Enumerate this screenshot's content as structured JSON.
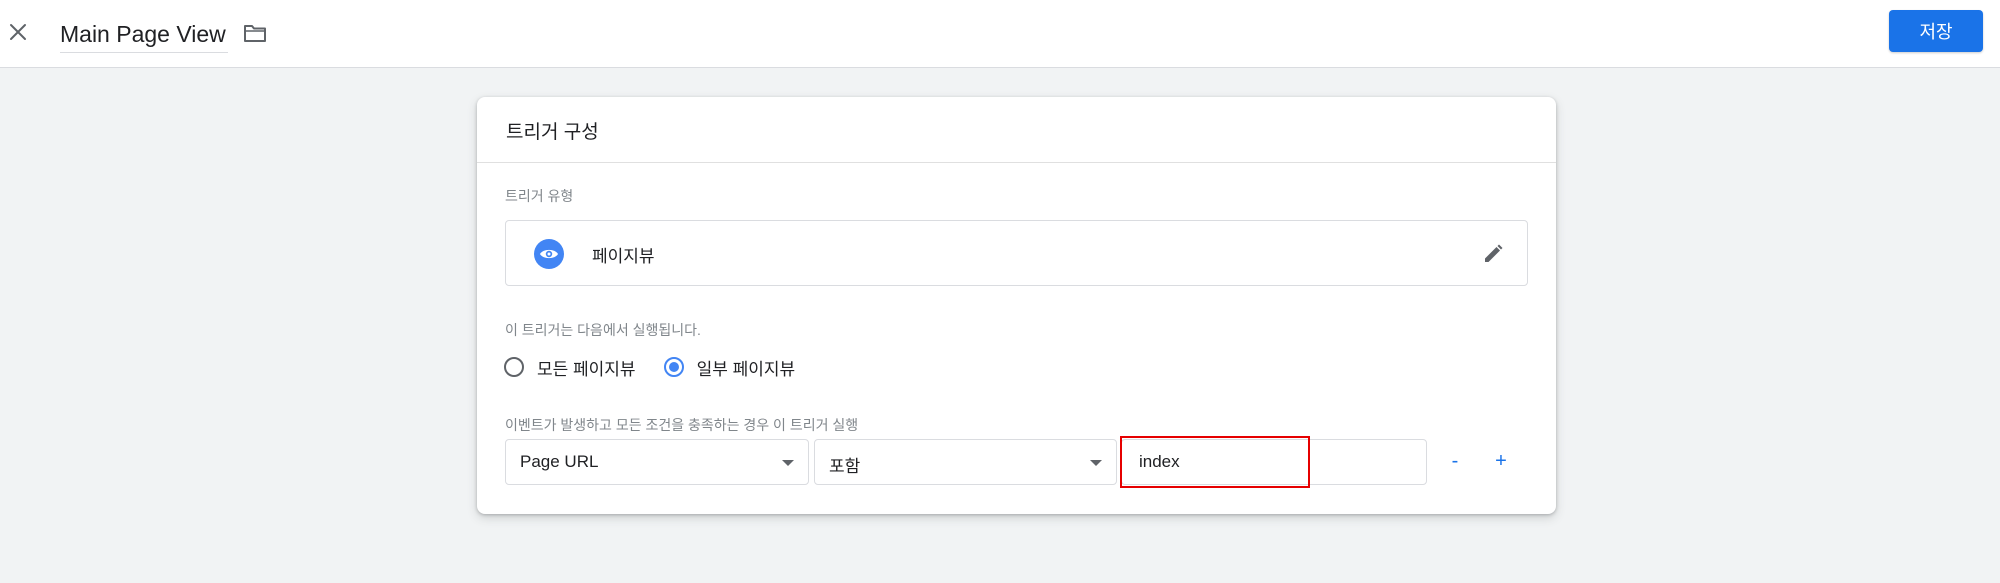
{
  "header": {
    "title": "Main Page View",
    "save_label": "저장",
    "close_icon": "close-icon",
    "folder_icon": "folder-icon"
  },
  "card": {
    "title": "트리거 구성",
    "trigger_type": {
      "label": "트리거 유형",
      "name": "페이지뷰",
      "icon": "eye-icon",
      "icon_color": "#4285f4",
      "edit_icon": "pencil-icon"
    },
    "fires_on": {
      "label": "이 트리거는 다음에서 실행됩니다.",
      "options": [
        {
          "label": "모든 페이지뷰",
          "checked": false
        },
        {
          "label": "일부 페이지뷰",
          "checked": true
        }
      ]
    },
    "condition": {
      "label": "이벤트가 발생하고 모든 조건을 충족하는 경우 이 트리거 실행",
      "variable": "Page URL",
      "operator": "포함",
      "value": "index",
      "minus_label": "-",
      "plus_label": "+"
    }
  },
  "colors": {
    "accent": "#1a73e8",
    "highlight": "#e60000"
  }
}
